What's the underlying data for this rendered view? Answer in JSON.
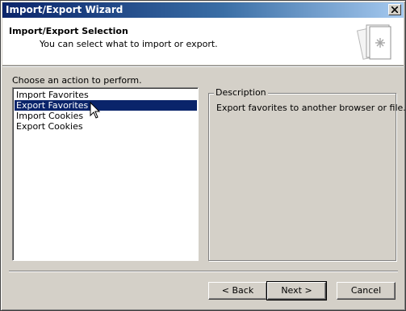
{
  "window": {
    "title": "Import/Export Wizard"
  },
  "header": {
    "title": "Import/Export Selection",
    "subtitle": "You can select what to import or export.",
    "icon": "wizard-book-icon"
  },
  "main": {
    "prompt": "Choose an action to perform.",
    "actions": [
      {
        "label": "Import Favorites",
        "selected": false
      },
      {
        "label": "Export Favorites",
        "selected": true
      },
      {
        "label": "Import Cookies",
        "selected": false
      },
      {
        "label": "Export Cookies",
        "selected": false
      }
    ],
    "description": {
      "legend": "Description",
      "text": "Export favorites to another browser or file."
    }
  },
  "footer": {
    "back_label": "< Back",
    "next_label": "Next >",
    "cancel_label": "Cancel"
  },
  "colors": {
    "titlebar_start": "#0a246a",
    "titlebar_end": "#a6caf0",
    "selection": "#0a246a",
    "face": "#d4d0c8"
  }
}
